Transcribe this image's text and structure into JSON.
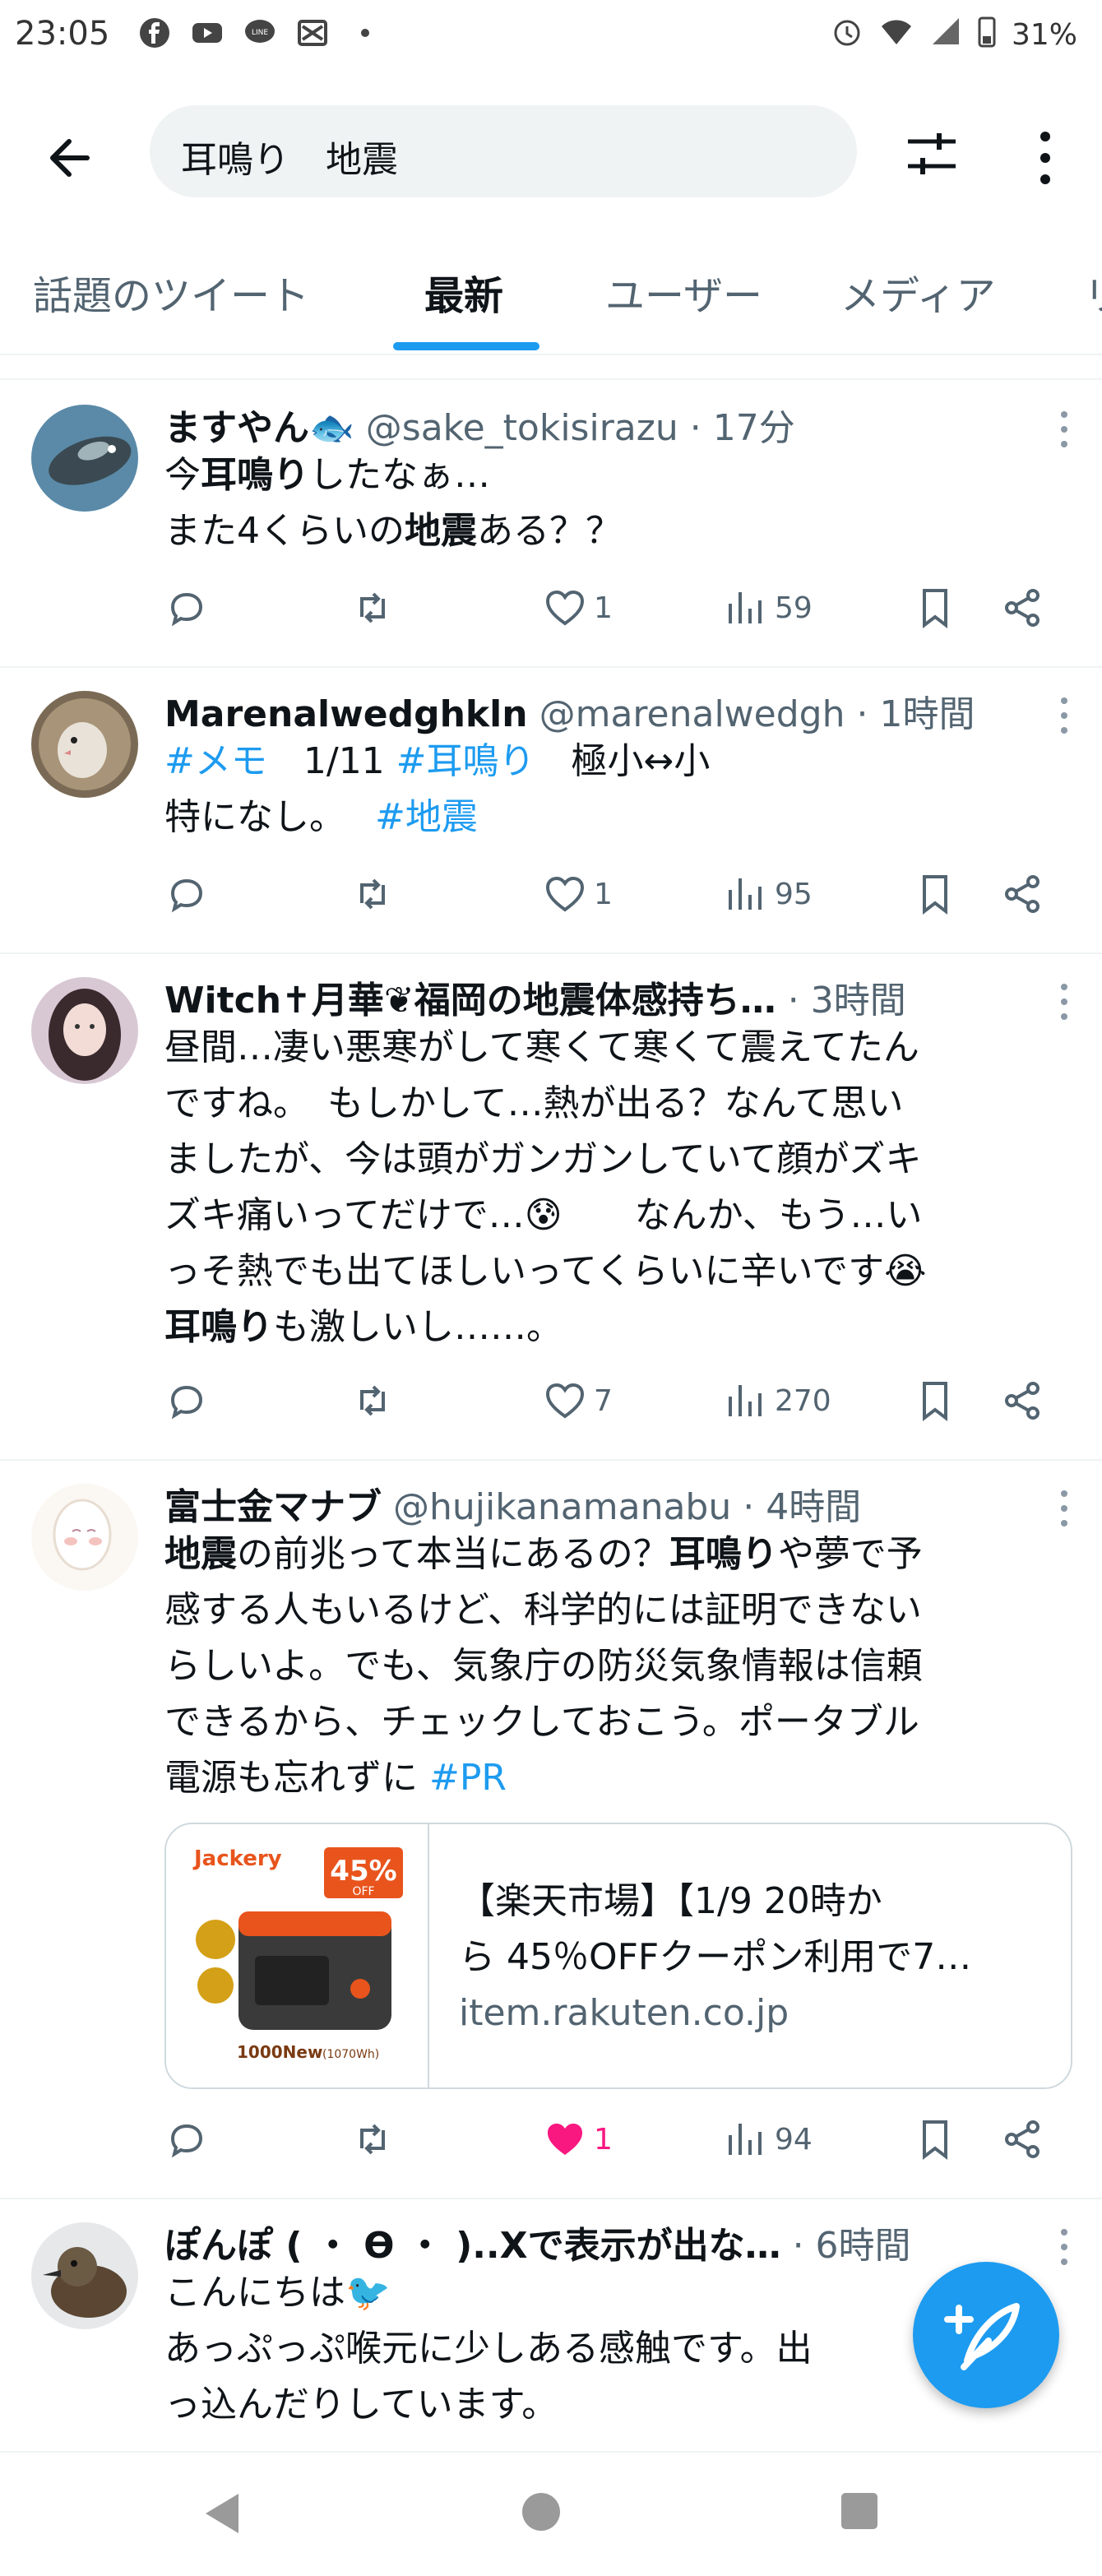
{
  "status_bar": {
    "time": "23:05",
    "battery": "31%"
  },
  "search": {
    "query": "耳鳴り　地震"
  },
  "tabs": [
    {
      "label": "話題のツイート",
      "active": false
    },
    {
      "label": "最新",
      "active": true
    },
    {
      "label": "ユーザー",
      "active": false
    },
    {
      "label": "メディア",
      "active": false
    },
    {
      "label": "リ",
      "active": false
    }
  ],
  "tweets": [
    {
      "name": "ますやん",
      "handle": "@sake_tokisirazu",
      "time": "· 17分",
      "lines": [
        [
          "今",
          "耳鳴り",
          "したなぁ…"
        ],
        [
          "また4くらいの",
          "地震",
          "ある？？"
        ]
      ],
      "replies": "",
      "likes": "1",
      "views": "59"
    },
    {
      "name": "Marenalwedghkln",
      "handle": "@marenalwedgh",
      "time": "· 1時間",
      "line1": {
        "tag1": "#メモ",
        "mid": "　1/11 ",
        "tag2": "#耳鳴り",
        "rest": "　極小↔小"
      },
      "line2": {
        "pre": "特になし。　 ",
        "tag": "#地震"
      },
      "likes": "1",
      "views": "95"
    },
    {
      "name": "Witch✝月華❦福岡の地震体感持ち…",
      "handle": "",
      "time": "· 3時間",
      "text_lines": [
        "昼間…凄い悪寒がして寒くて寒くて震えてたん",
        "ですね。　もしかして…熱が出る？なんて思い",
        "ましたが、今は頭がガンガンしていて顔がズキ",
        "ズキ痛いってだけで…😰　　なんか、もう…い",
        "っそ熱でも出てほしいってくらいに辛いです😭"
      ],
      "last_kw": "耳鳴り",
      "last_rest": "も激しいし……。",
      "likes": "7",
      "views": "270"
    },
    {
      "name": "富士金マナブ",
      "handle": "@hujikanamanabu",
      "time": "· 4時間",
      "line1": {
        "kw1": "地震",
        "mid": "の前兆って本当にあるの？",
        "kw2": "耳鳴り",
        "rest": "や夢で予"
      },
      "text_lines": [
        "感する人もいるけど、科学的には証明できない",
        "らしいよ。でも、気象庁の防災気象情報は信頼",
        "できるから、チェックしておこう。ポータブル"
      ],
      "last_pre": "電源も忘れずに ",
      "last_tag": "#PR",
      "card": {
        "brand": "Jackery",
        "badge": "45%",
        "badge_sub": "OFF",
        "model": "1000New",
        "model_sub": "(1070Wh)",
        "title1": "【楽天市場】【1/9 20時か",
        "title2": "ら 45％OFFクーポン利用で7…",
        "domain": "item.rakuten.co.jp"
      },
      "likes": "1",
      "views": "94"
    },
    {
      "name": "ぽんぽ ( ・ ϴ ・ )..Xで表示が出な…",
      "handle": "",
      "time": "· 6時間",
      "text_lines": [
        "こんにちは🐦",
        "あっぷっぷ喉元に少しある感触です。出",
        "っ込んだりしています。"
      ]
    }
  ],
  "colors": {
    "accent": "#1d9bf0",
    "like_active": "#f91880",
    "muted": "#536471"
  },
  "icons": [
    "reply-icon",
    "retweet-icon",
    "heart-icon",
    "views-icon",
    "bookmark-icon",
    "share-icon",
    "compose-icon"
  ]
}
